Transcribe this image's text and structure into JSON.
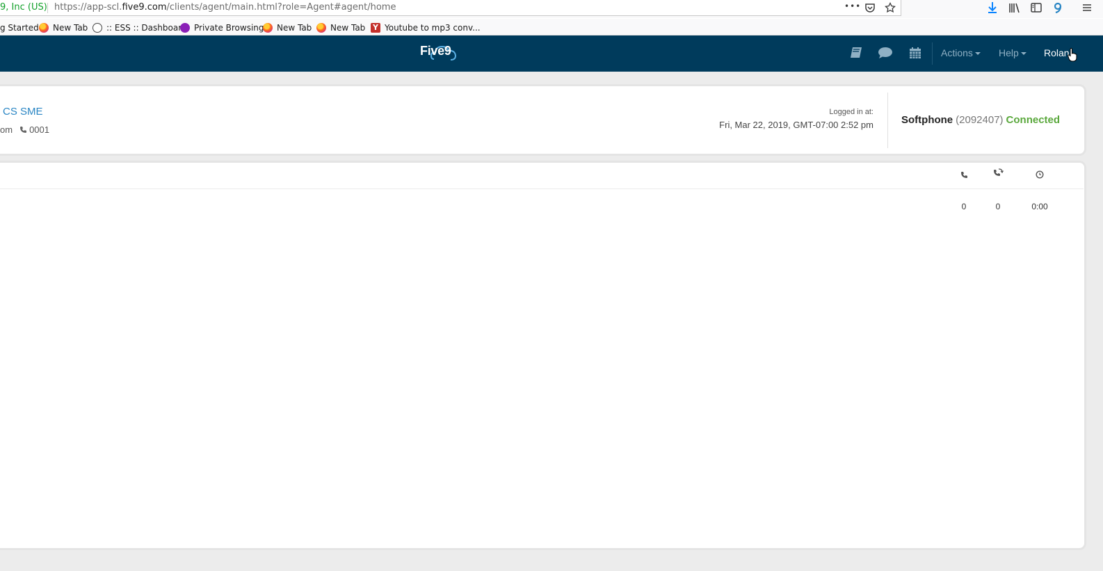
{
  "browser": {
    "site_identity": "9, Inc (US)",
    "url_prefix": "https://app-scl.",
    "url_host": "five9.com",
    "url_path": "/clients/agent/main.html?role=Agent#agent/home",
    "page_actions_glyph": "•••",
    "bookmarks": [
      {
        "label": "g Started",
        "icon": "none"
      },
      {
        "label": "New Tab",
        "icon": "firefox-icon"
      },
      {
        "label": ":: ESS :: Dashboard",
        "icon": "globe-icon"
      },
      {
        "label": "Private Browsing",
        "icon": "private-browsing-icon"
      },
      {
        "label": "New Tab",
        "icon": "firefox-icon"
      },
      {
        "label": "New Tab",
        "icon": "firefox-icon"
      },
      {
        "label": "Youtube to mp3 conv...",
        "icon": "y-icon"
      }
    ]
  },
  "header": {
    "logo_text": "Five9",
    "menus": {
      "actions": "Actions",
      "help": "Help"
    },
    "user": "Rolan"
  },
  "agent": {
    "name": "CS SME",
    "meta_suffix": "om",
    "extension": "0001",
    "logged_in_label": "Logged in at:",
    "logged_in_time": "Fri, Mar 22, 2019, GMT-07:00 2:52 pm",
    "softphone_label": "Softphone",
    "softphone_number": "(2092407)",
    "softphone_status": "Connected"
  },
  "stats": {
    "columns": [
      {
        "icon": "phone-icon",
        "value": "0"
      },
      {
        "icon": "callback-icon",
        "value": "0"
      },
      {
        "icon": "clock-icon",
        "value": "0:00"
      }
    ]
  },
  "colors": {
    "header_bg": "#003b5c",
    "link": "#2a86c4",
    "connected": "#5aa83c"
  }
}
